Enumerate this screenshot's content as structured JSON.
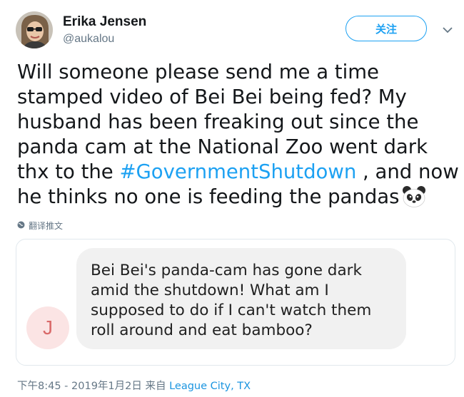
{
  "author": {
    "name": "Erika Jensen",
    "handle": "@aukalou"
  },
  "follow_label": "关注",
  "tweet": {
    "text_before": "Will someone please send me a time stamped video of Bei Bei being fed? My husband has been freaking out since the panda cam at the National Zoo went dark thx to the ",
    "hashtag": "#GovernmentShutdown",
    "text_after": " , and now he thinks no one is feeding the pandas",
    "emoji": "panda-face-emoji"
  },
  "translate_label": "翻译推文",
  "quoted": {
    "avatar_letter": "J",
    "message": "Bei Bei's panda-cam has gone dark amid the shutdown! What am I supposed to do if I can't watch them roll around and eat bamboo?"
  },
  "meta": {
    "timestamp": "下午8:45 - 2019年1月2日",
    "via": "来自",
    "place": "League City, TX"
  },
  "colors": {
    "accent": "#1da1f2",
    "secondary_text": "#657786"
  }
}
